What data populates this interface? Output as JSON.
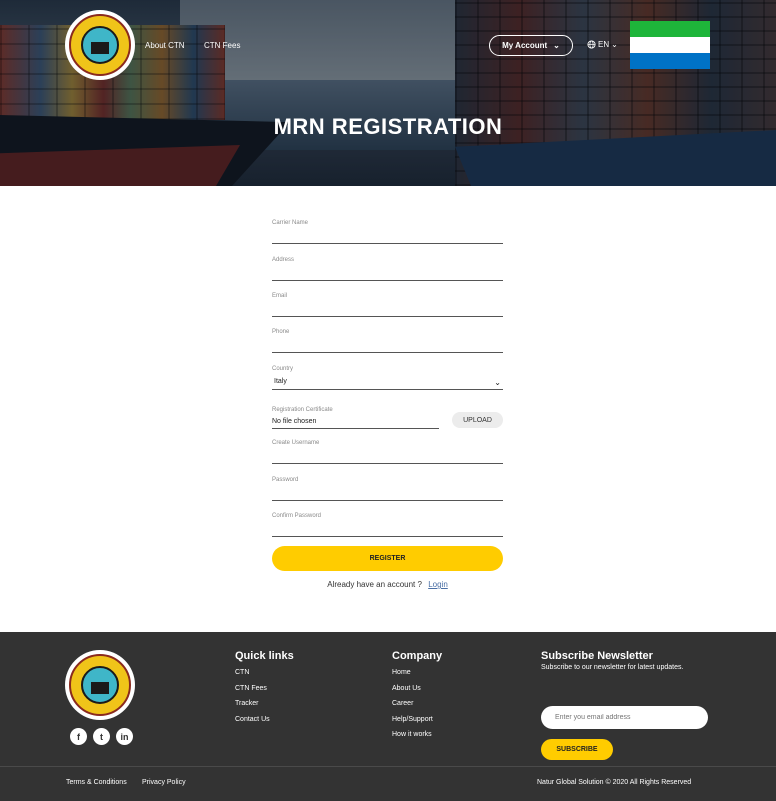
{
  "header": {
    "nav": [
      "About CTN",
      "CTN Fees"
    ],
    "account_label": "My Account",
    "language": "EN",
    "flag_colors": [
      "#1eb53a",
      "#ffffff",
      "#0072c6"
    ],
    "title": "MRN REGISTRATION"
  },
  "form": {
    "carrier_name": {
      "label": "Carrier Name",
      "value": ""
    },
    "address": {
      "label": "Address",
      "value": ""
    },
    "email": {
      "label": "Email",
      "value": ""
    },
    "phone": {
      "label": "Phone",
      "value": ""
    },
    "country": {
      "label": "Country",
      "value": "Italy"
    },
    "certificate": {
      "label": "Registration Certificate",
      "value": "No file chosen",
      "upload_label": "UPLOAD"
    },
    "username": {
      "label": "Create Username",
      "value": ""
    },
    "password": {
      "label": "Password",
      "value": ""
    },
    "confirm_password": {
      "label": "Confirm Password",
      "value": ""
    },
    "register_label": "REGISTER",
    "already_text": "Already have an account ?",
    "login_label": "Login"
  },
  "footer": {
    "quick_links": {
      "title": "Quick links",
      "items": [
        "CTN",
        "CTN Fees",
        "Tracker",
        "Contact Us"
      ]
    },
    "company": {
      "title": "Company",
      "items": [
        "Home",
        "About Us",
        "Career",
        "Help/Support",
        "How it works"
      ]
    },
    "newsletter": {
      "title": "Subscribe Newsletter",
      "subtitle": "Subscribe to our newsletter for latest updates.",
      "placeholder": "Enter you email address",
      "button_label": "SUBSCRIBE"
    },
    "socials": [
      "f",
      "t",
      "in"
    ],
    "terms": "Terms & Conditions",
    "privacy": "Privacy Policy",
    "copyright": "Natur Global Solution © 2020 All Rights Reserved"
  },
  "colors": {
    "accent": "#ffcc00",
    "footer_bg": "#333333"
  }
}
